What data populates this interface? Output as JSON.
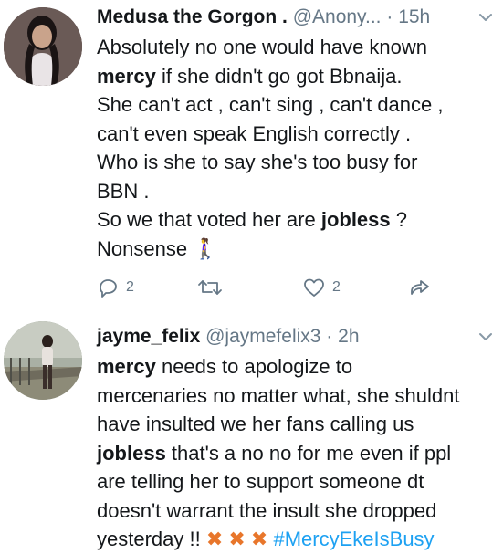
{
  "tweets": [
    {
      "name": "Medusa the Gorgon .",
      "handle": "@Anony...",
      "separator": "·",
      "time": "15h",
      "lines": [
        {
          "parts": [
            {
              "t": "Absolutely no one would have known"
            }
          ]
        },
        {
          "parts": [
            {
              "t": "mercy",
              "b": true
            },
            {
              "t": " if she didn't go got Bbnaija."
            }
          ]
        },
        {
          "parts": [
            {
              "t": "She can't act , can't sing , can't dance ,"
            }
          ]
        },
        {
          "parts": [
            {
              "t": "can't even speak English correctly ."
            }
          ]
        },
        {
          "parts": [
            {
              "t": "Who is she to say she's too busy for"
            }
          ]
        },
        {
          "parts": [
            {
              "t": "BBN ."
            }
          ]
        },
        {
          "parts": [
            {
              "t": "So we that voted her are "
            },
            {
              "t": "jobless",
              "b": true
            },
            {
              "t": " ?"
            }
          ]
        },
        {
          "parts": [
            {
              "t": "Nonsense "
            },
            {
              "t": "🚶‍♀️",
              "emoji": true
            }
          ]
        }
      ],
      "reply_count": "2",
      "retweet_count": "",
      "like_count": "2"
    },
    {
      "name": "jayme_felix",
      "handle": "@jaymefelix3",
      "separator": "·",
      "time": "2h",
      "lines": [
        {
          "parts": [
            {
              "t": "mercy",
              "b": true
            },
            {
              "t": " needs to apologize to"
            }
          ]
        },
        {
          "parts": [
            {
              "t": "mercenaries no matter what, she shuldnt"
            }
          ]
        },
        {
          "parts": [
            {
              "t": "have insulted we her fans calling us"
            }
          ]
        },
        {
          "parts": [
            {
              "t": "jobless",
              "b": true
            },
            {
              "t": " that's a no no for me even if ppl"
            }
          ]
        },
        {
          "parts": [
            {
              "t": "are telling her to support someone dt"
            }
          ]
        },
        {
          "parts": [
            {
              "t": "doesn't warrant the insult she dropped"
            }
          ]
        },
        {
          "parts": [
            {
              "t": "yesterday !! "
            },
            {
              "t": "✖ ✖ ✖",
              "x": true
            },
            {
              "t": " "
            },
            {
              "t": "#MercyEkeIsBusy",
              "tag": true
            }
          ]
        }
      ]
    }
  ],
  "icons": {
    "menu": "chevron-down-icon",
    "reply": "reply-icon",
    "retweet": "retweet-icon",
    "like": "heart-icon",
    "share": "share-icon"
  },
  "colors": {
    "text": "#14171a",
    "muted": "#657786",
    "link": "#1da1f2",
    "divider": "#e1e8ed"
  }
}
